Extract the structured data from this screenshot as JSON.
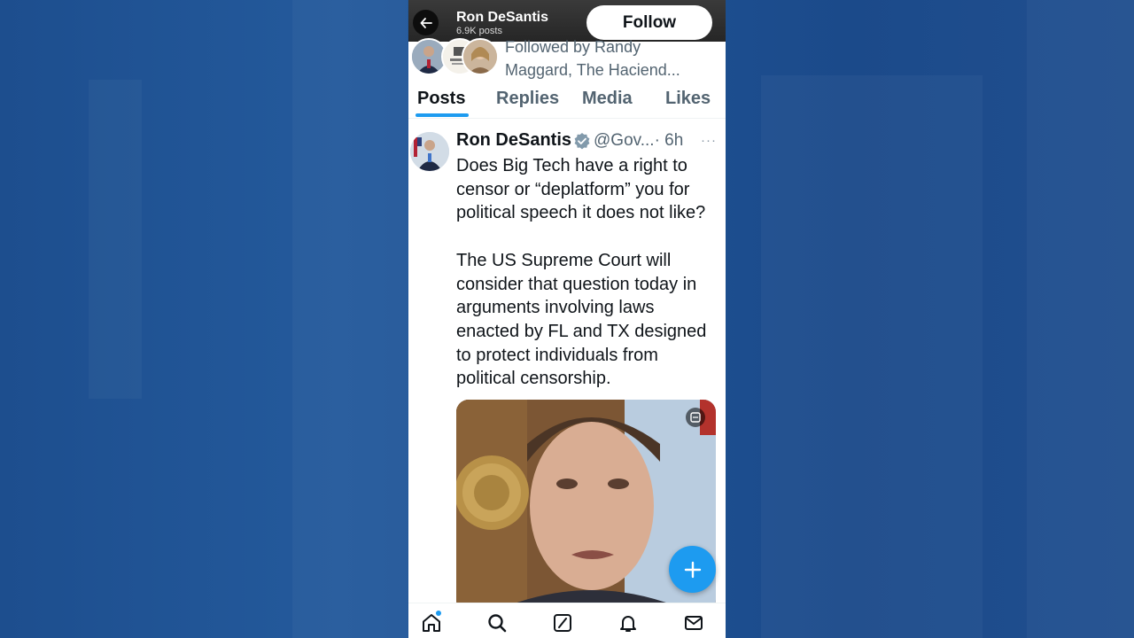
{
  "header": {
    "name": "Ron DeSantis",
    "posts_count": "6.9K posts",
    "follow_label": "Follow"
  },
  "profile": {
    "followed_by_text": "Followed by Randy Maggard, The Haciend..."
  },
  "tabs": [
    {
      "label": "Posts",
      "active": true
    },
    {
      "label": "Replies",
      "active": false
    },
    {
      "label": "Media",
      "active": false
    },
    {
      "label": "Likes",
      "active": false
    }
  ],
  "tweet": {
    "author_name": "Ron DeSantis",
    "handle": "@Gov...",
    "time": "· 6h",
    "more": "···",
    "text": "Does Big Tech have a right to censor or “deplatform” you for political speech it does not like?\n\nThe US Supreme Court will consider that question today in arguments involving laws enacted by FL and TX designed to protect individuals from political censorship.",
    "verified": true
  },
  "bottom_nav": [
    {
      "icon": "home-icon"
    },
    {
      "icon": "search-icon"
    },
    {
      "icon": "grok-icon"
    },
    {
      "icon": "bell-icon"
    },
    {
      "icon": "mail-icon"
    }
  ],
  "colors": {
    "accent": "#1d9bf0",
    "text_primary": "#0f1419",
    "text_secondary": "#536471",
    "background_blue": "#1e5294"
  }
}
